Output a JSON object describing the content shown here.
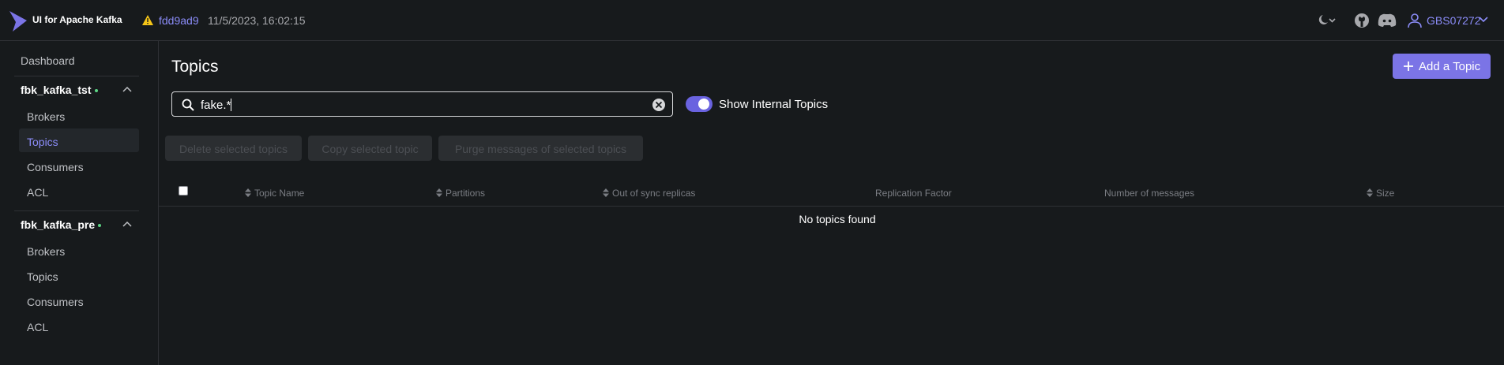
{
  "header": {
    "brand": "UI for Apache Kafka",
    "commit": "fdd9ad9",
    "commit_date": "11/5/2023, 16:02:15",
    "user": "GBS07272",
    "icons": [
      "moon-icon",
      "github-icon",
      "discord-icon",
      "user-icon"
    ]
  },
  "sidebar": {
    "dashboard": "Dashboard",
    "clusters": [
      {
        "name": "fbk_kafka_tst",
        "status": "online",
        "items": [
          "Brokers",
          "Topics",
          "Consumers",
          "ACL"
        ],
        "active": "Topics"
      },
      {
        "name": "fbk_kafka_pre",
        "status": "online",
        "items": [
          "Brokers",
          "Topics",
          "Consumers",
          "ACL"
        ]
      }
    ]
  },
  "main": {
    "title": "Topics",
    "add_button": "Add a Topic",
    "search_value": "fake.*",
    "toggle_label": "Show Internal Topics",
    "toggle_on": true,
    "bulk_actions": [
      "Delete selected topics",
      "Copy selected topic",
      "Purge messages of selected topics"
    ],
    "columns": [
      "Topic Name",
      "Partitions",
      "Out of sync replicas",
      "Replication Factor",
      "Number of messages",
      "Size"
    ],
    "empty_message": "No topics found"
  },
  "colors": {
    "accent": "#7b74e6",
    "link": "#8b8cf8",
    "background": "#171a1c",
    "online": "#5cd685",
    "warning": "#f5c518"
  }
}
